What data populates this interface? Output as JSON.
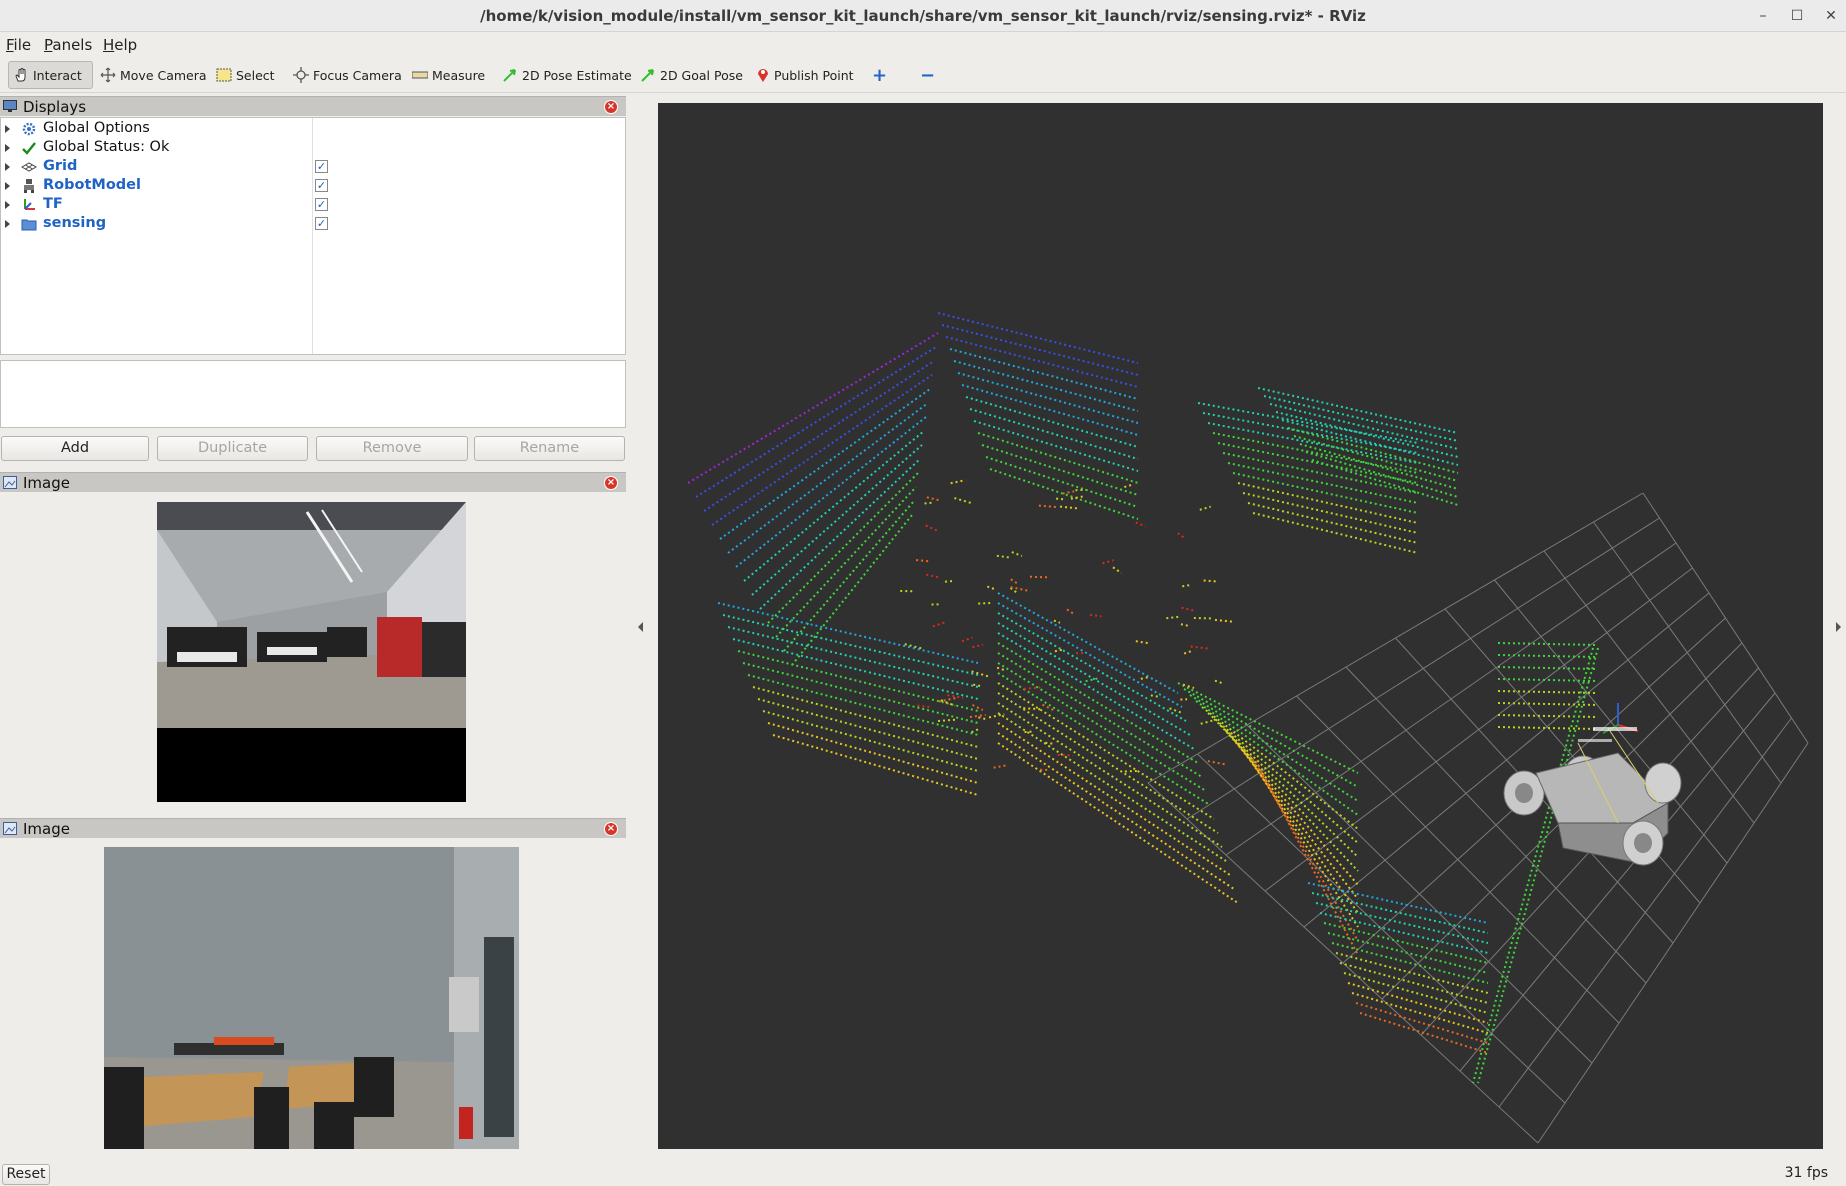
{
  "window": {
    "title": "/home/k/vision_module/install/vm_sensor_kit_launch/share/vm_sensor_kit_launch/rviz/sensing.rviz* - RViz",
    "minimize_glyph": "–",
    "maximize_glyph": "☐",
    "close_glyph": "✕"
  },
  "menu": [
    "File",
    "Panels",
    "Help"
  ],
  "toolbar": {
    "tools": [
      {
        "label": "Interact",
        "icon": "hand-icon",
        "active": true
      },
      {
        "label": "Move Camera",
        "icon": "move-camera-icon"
      },
      {
        "label": "Select",
        "icon": "select-box-icon"
      },
      {
        "label": "Focus Camera",
        "icon": "focus-camera-icon"
      },
      {
        "label": "Measure",
        "icon": "ruler-icon"
      },
      {
        "label": "2D Pose Estimate",
        "icon": "green-arrow-icon"
      },
      {
        "label": "2D Goal Pose",
        "icon": "green-arrow-icon"
      },
      {
        "label": "Publish Point",
        "icon": "map-pin-icon"
      }
    ],
    "add_tool_glyph": "+",
    "remove_tool_glyph": "−"
  },
  "displays_panel": {
    "title": "Displays",
    "items": [
      {
        "label": "Global Options",
        "icon": "gear-icon",
        "plugin": false
      },
      {
        "label": "Global Status: Ok",
        "icon": "checkmark-icon",
        "plugin": false
      },
      {
        "label": "Grid",
        "icon": "grid-icon",
        "plugin": true,
        "checked": true
      },
      {
        "label": "RobotModel",
        "icon": "robot-icon",
        "plugin": true,
        "checked": true
      },
      {
        "label": "TF",
        "icon": "axes-icon",
        "plugin": true,
        "checked": true
      },
      {
        "label": "sensing",
        "icon": "folder-icon",
        "plugin": true,
        "checked": true
      }
    ],
    "check_glyph": "✓",
    "buttons": {
      "add": "Add",
      "duplicate": "Duplicate",
      "remove": "Remove",
      "rename": "Rename"
    }
  },
  "image_panels": [
    {
      "title": "Image"
    },
    {
      "title": "Image"
    }
  ],
  "status": {
    "reset_label": "Reset",
    "fps": "31 fps"
  },
  "colors": {
    "background_3d": "#303030",
    "plugin_label": "#1f63c4",
    "panel_header": "#c9c7c3",
    "close_red": "#d8352a"
  }
}
